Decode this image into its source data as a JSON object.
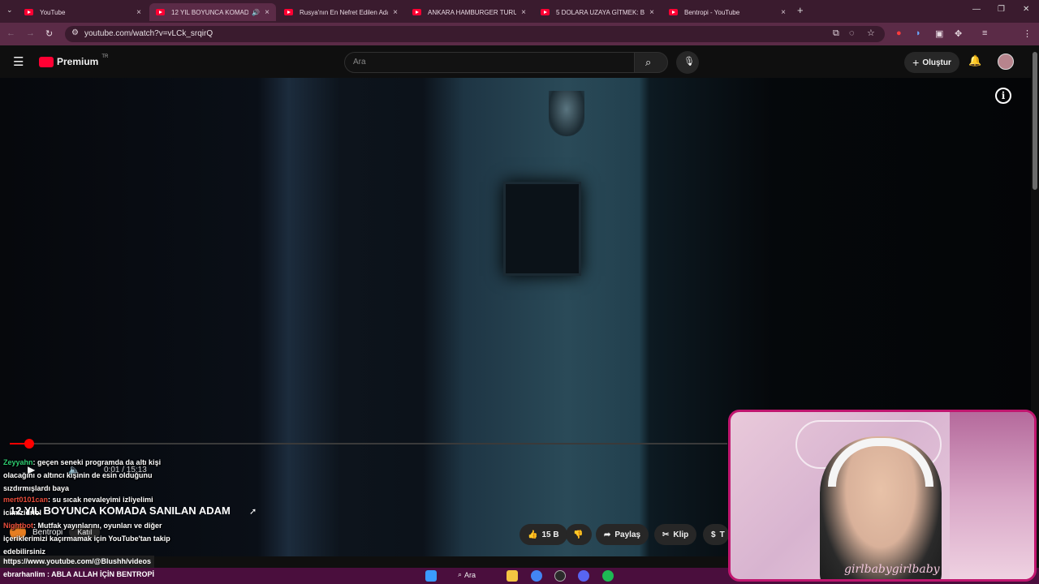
{
  "browser": {
    "tabs": [
      {
        "title": "YouTube"
      },
      {
        "title": "12 YIL BOYUNCA KOMADA"
      },
      {
        "title": "Rusya'nın En Nefret Edilen Ada"
      },
      {
        "title": "ANKARA HAMBURGER TURU!"
      },
      {
        "title": "5 DOLARA UZAYA GİTMEK: Bir"
      },
      {
        "title": "Bentropi - YouTube"
      }
    ],
    "new_tab": "+",
    "url": "youtube.com/watch?v=vLCk_srqirQ"
  },
  "youtube": {
    "logo_text": "Premium",
    "region": "TR",
    "search_placeholder": "Ara",
    "create_label": "Oluştur"
  },
  "video": {
    "timecode": "0:01 / 15:13",
    "progress_fraction": 0.02,
    "title": "12 YIL BOYUNCA KOMADA SANILAN ADAM",
    "channel": "Bentropi",
    "join_label": "Katıl",
    "likes": "15 B",
    "share_label": "Paylaş",
    "clip_label": "Klip",
    "thanks_label": "T"
  },
  "chat": [
    {
      "user": "Zeyyahn",
      "text": ": geçen seneki programda da altı kişi olacağını o altıncı kişinin de esin olduğunu sızdırmışlardı baya"
    },
    {
      "user": "mert0101can",
      "text": ": su sıcak nevaleyimi izliyelimi icimizidriol"
    },
    {
      "user": "Nightbot",
      "text": ": Mutfak yayınlarını, oyunları ve diğer içeriklerimizi kaçırmamak için YouTube'tan takip edebilirsiniz"
    }
  ],
  "status_url": "https://www.youtube.com/@Blushh/videos",
  "bottom_message": "ebrarhanlim : ABLA ALLAH İÇİN BENTROPİ",
  "taskbar": {
    "search_label": "Ara"
  },
  "facecam": {
    "overlay_text": "girlbabygirlbaby"
  },
  "colors": {
    "accent": "#ff0033",
    "frame": "#c0166f",
    "taskbar": "#4a0e3d"
  }
}
